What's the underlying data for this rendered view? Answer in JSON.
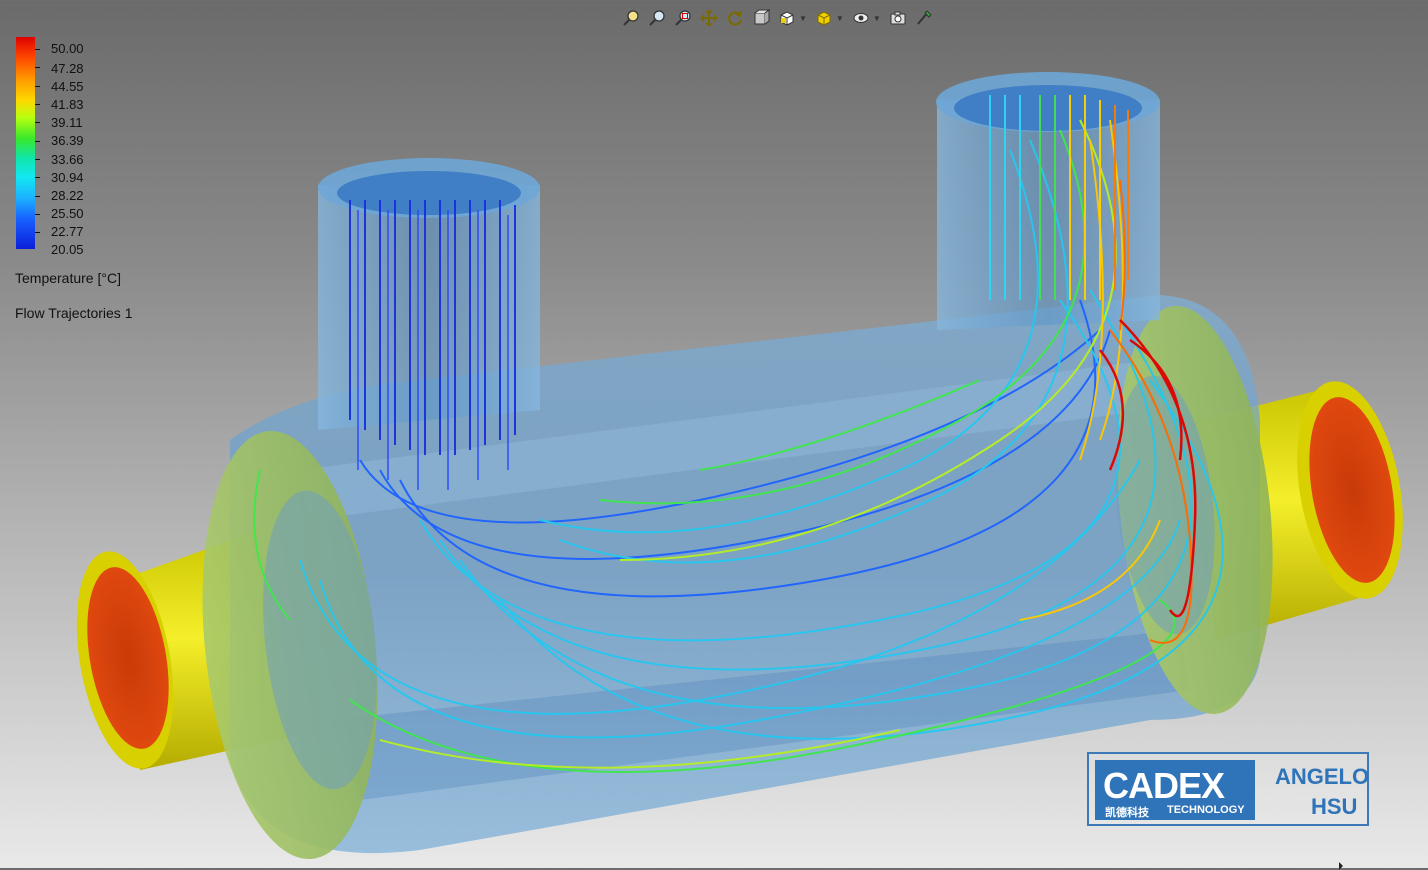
{
  "toolbar": {
    "tools": [
      {
        "name": "zoom-to-fit-icon"
      },
      {
        "name": "zoom-in-out-icon"
      },
      {
        "name": "zoom-to-area-icon"
      },
      {
        "name": "pan-icon"
      },
      {
        "name": "rotate-icon"
      },
      {
        "name": "section-view-icon"
      },
      {
        "name": "view-orientation-icon"
      },
      {
        "name": "display-style-icon"
      },
      {
        "name": "hide-show-icon"
      },
      {
        "name": "camera-icon"
      },
      {
        "name": "apply-scene-icon"
      }
    ]
  },
  "legend": {
    "values": [
      "50.00",
      "47.28",
      "44.55",
      "41.83",
      "39.11",
      "36.39",
      "33.66",
      "30.94",
      "28.22",
      "25.50",
      "22.77",
      "20.05"
    ],
    "title": "Temperature [°C]",
    "plot_name": "Flow Trajectories 1",
    "colors": {
      "max": "#e00000",
      "min": "#0b1ed8"
    }
  },
  "watermark": {
    "brand": "CADEX",
    "subtitle_cn": "凯德科技",
    "subtitle_en": "TECHNOLOGY",
    "name_line1": "ANGELO",
    "name_line2": "HSU",
    "color": "#2f73b8"
  }
}
